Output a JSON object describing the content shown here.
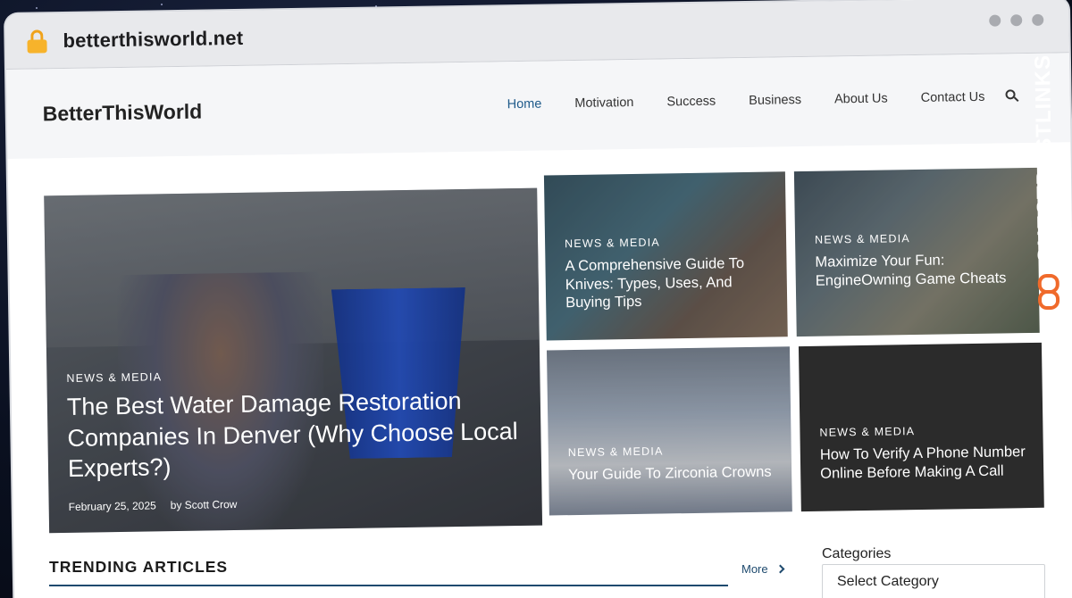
{
  "browser": {
    "url": "betterthisworld.net"
  },
  "header": {
    "logo": "BetterThisWorld",
    "nav": [
      {
        "label": "Home"
      },
      {
        "label": "Motivation"
      },
      {
        "label": "Success"
      },
      {
        "label": "Business"
      },
      {
        "label": "About Us"
      },
      {
        "label": "Contact Us"
      }
    ],
    "active_nav": "Home"
  },
  "featured": {
    "category": "NEWS & MEDIA",
    "title": "The Best Water Damage Restoration Companies In Denver (Why Choose Local Experts?)",
    "date": "February 25, 2025",
    "author": "by Scott Crow"
  },
  "cards": [
    {
      "category": "NEWS & MEDIA",
      "title": "A Comprehensive Guide To Knives: Types, Uses, And Buying Tips"
    },
    {
      "category": "NEWS & MEDIA",
      "title": "Maximize Your Fun: EngineOwning Game Cheats"
    },
    {
      "category": "NEWS & MEDIA",
      "title": "Your Guide To Zirconia Crowns"
    },
    {
      "category": "NEWS & MEDIA",
      "title": "How To Verify A Phone Number Online Before Making A Call"
    }
  ],
  "trending": {
    "heading": "TRENDING ARTICLES",
    "more_label": "More"
  },
  "sidebar": {
    "categories_label": "Categories",
    "select_value": "Select Category"
  },
  "badge": {
    "text": "GUESTPOSTLINKS"
  },
  "colors": {
    "accent": "#1e5a8a",
    "badge_orange": "#f06a2b",
    "lock": "#f7b32b"
  }
}
